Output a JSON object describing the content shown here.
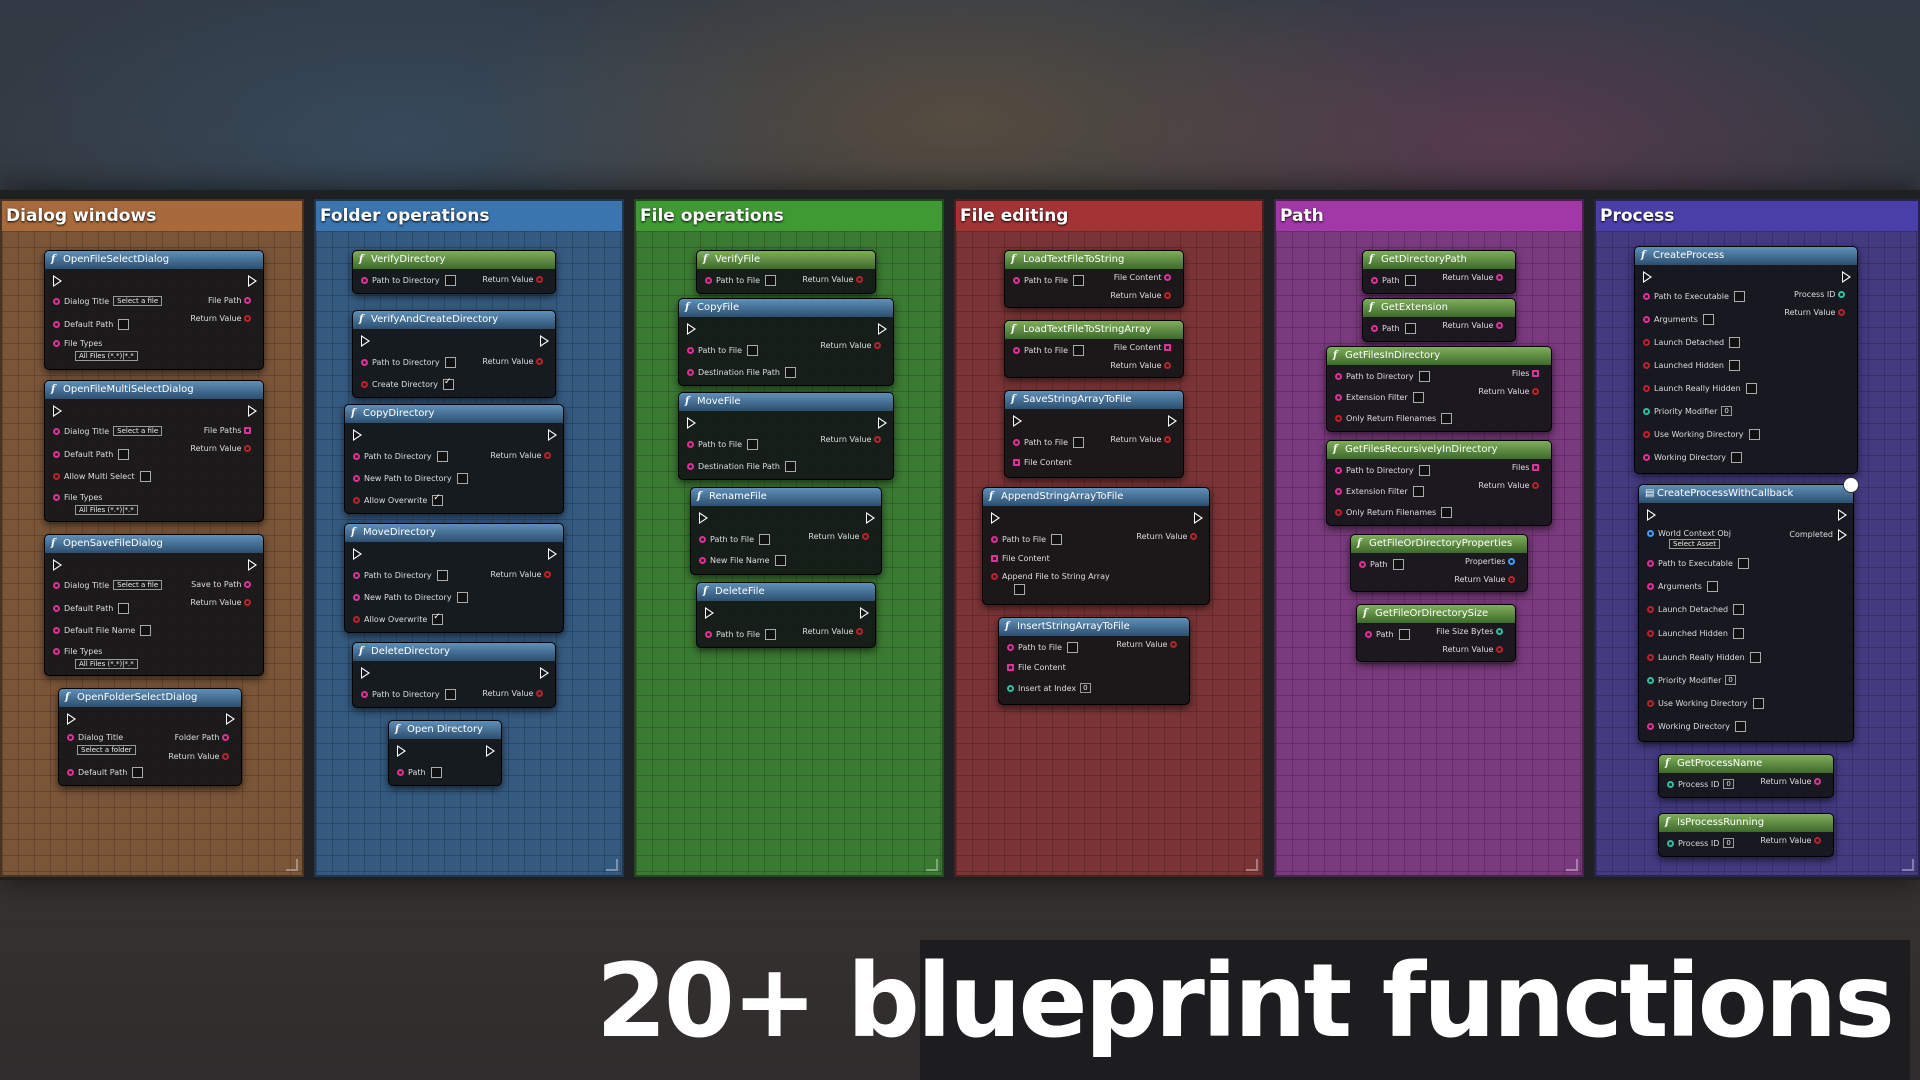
{
  "banner": "20+ blueprint functions",
  "columns": [
    {
      "title": "Dialog windows",
      "color": "#a86a3c"
    },
    {
      "title": "Folder operations",
      "color": "#3a75b0"
    },
    {
      "title": "File operations",
      "color": "#3f9a34"
    },
    {
      "title": "File editing",
      "color": "#a23436"
    },
    {
      "title": "Path",
      "color": "#a238a8"
    },
    {
      "title": "Process",
      "color": "#4a3ea8"
    }
  ],
  "nodes": {
    "openFileSelectDialog": {
      "title": "OpenFileSelectDialog",
      "dialog_title": "Dialog Title",
      "dialog_title_value": "Select a file",
      "default_path": "Default Path",
      "file_types": "File Types",
      "file_types_value": "All Files (*.*)|*.*",
      "out1": "File Path",
      "out2": "Return Value"
    },
    "openFileMultiSelectDialog": {
      "title": "OpenFileMultiSelectDialog",
      "dialog_title": "Dialog Title",
      "dialog_title_value": "Select a file",
      "default_path": "Default Path",
      "allow_multi": "Allow Multi Select",
      "file_types": "File Types",
      "file_types_value": "All Files (*.*)|*.*",
      "out1": "File Paths",
      "out2": "Return Value"
    },
    "openSaveFileDialog": {
      "title": "OpenSaveFileDialog",
      "dialog_title": "Dialog Title",
      "dialog_title_value": "Select a file",
      "default_path": "Default Path",
      "default_file_name": "Default File Name",
      "file_types": "File Types",
      "file_types_value": "All Files (*.*)|*.*",
      "out1": "Save to Path",
      "out2": "Return Value"
    },
    "openFolderSelectDialog": {
      "title": "OpenFolderSelectDialog",
      "dialog_title": "Dialog Title",
      "dialog_title_value": "Select a folder",
      "default_path": "Default Path",
      "out1": "Folder Path",
      "out2": "Return Value"
    },
    "verifyDirectory": {
      "title": "VerifyDirectory",
      "in1": "Path to Directory",
      "out1": "Return Value"
    },
    "verifyAndCreateDirectory": {
      "title": "VerifyAndCreateDirectory",
      "in1": "Path to Directory",
      "in2": "Create Directory",
      "out1": "Return Value"
    },
    "copyDirectory": {
      "title": "CopyDirectory",
      "in1": "Path to Directory",
      "in2": "New Path to Directory",
      "in3": "Allow Overwrite",
      "out1": "Return Value"
    },
    "moveDirectory": {
      "title": "MoveDirectory",
      "in1": "Path to Directory",
      "in2": "New Path to Directory",
      "in3": "Allow Overwrite",
      "out1": "Return Value"
    },
    "deleteDirectory": {
      "title": "DeleteDirectory",
      "in1": "Path to Directory",
      "out1": "Return Value"
    },
    "openDirectory": {
      "title": "Open Directory",
      "in1": "Path"
    },
    "verifyFile": {
      "title": "VerifyFile",
      "in1": "Path to File",
      "out1": "Return Value"
    },
    "copyFile": {
      "title": "CopyFile",
      "in1": "Path to File",
      "in2": "Destination File Path",
      "out1": "Return Value"
    },
    "moveFile": {
      "title": "MoveFile",
      "in1": "Path to File",
      "in2": "Destination File Path",
      "out1": "Return Value"
    },
    "renameFile": {
      "title": "RenameFile",
      "in1": "Path to File",
      "in2": "New File Name",
      "out1": "Return Value"
    },
    "deleteFile": {
      "title": "DeleteFile",
      "in1": "Path to File",
      "out1": "Return Value"
    },
    "loadTextFileToString": {
      "title": "LoadTextFileToString",
      "in1": "Path to File",
      "out1": "File Content",
      "out2": "Return Value"
    },
    "loadTextFileToStringArray": {
      "title": "LoadTextFileToStringArray",
      "in1": "Path to File",
      "out1": "File Content",
      "out2": "Return Value"
    },
    "saveStringArrayToFile": {
      "title": "SaveStringArrayToFile",
      "in1": "Path to File",
      "in2": "File Content",
      "out1": "Return Value"
    },
    "appendStringArrayToFile": {
      "title": "AppendStringArrayToFile",
      "in1": "Path to File",
      "in2": "File Content",
      "in3": "Append File to String Array",
      "out1": "Return Value"
    },
    "insertStringArrayToFile": {
      "title": "InsertStringArrayToFile",
      "in1": "Path to File",
      "in2": "File Content",
      "in3": "Insert at Index",
      "in3_value": "0",
      "out1": "Return Value"
    },
    "getDirectoryPath": {
      "title": "GetDirectoryPath",
      "in1": "Path",
      "out1": "Return Value"
    },
    "getExtension": {
      "title": "GetExtension",
      "in1": "Path",
      "out1": "Return Value"
    },
    "getFilesInDirectory": {
      "title": "GetFilesInDirectory",
      "in1": "Path to Directory",
      "in2": "Extension Filter",
      "in3": "Only Return Filenames",
      "out1": "Files",
      "out2": "Return Value"
    },
    "getFilesRecursivelyInDirectory": {
      "title": "GetFilesRecursivelyInDirectory",
      "in1": "Path to Directory",
      "in2": "Extension Filter",
      "in3": "Only Return Filenames",
      "out1": "Files",
      "out2": "Return Value"
    },
    "getFileOrDirectoryProperties": {
      "title": "GetFileOrDirectoryProperties",
      "in1": "Path",
      "out1": "Properties",
      "out2": "Return Value"
    },
    "getFileOrDirectorySize": {
      "title": "GetFileOrDirectorySize",
      "in1": "Path",
      "out1": "File Size Bytes",
      "out2": "Return Value"
    },
    "createProcess": {
      "title": "CreateProcess",
      "in1": "Path to Executable",
      "in2": "Arguments",
      "in3": "Launch Detached",
      "in4": "Launched Hidden",
      "in5": "Launch Really Hidden",
      "in6": "Priority Modifier",
      "in6_value": "0",
      "in7": "Use Working Directory",
      "in8": "Working Directory",
      "out1": "Process ID",
      "out2": "Return Value"
    },
    "createProcessWithCallback": {
      "title": "CreateProcessWithCallback",
      "in0": "World Context Obj",
      "in0_value": "Select Asset",
      "in1": "Path to Executable",
      "in2": "Arguments",
      "in3": "Launch Detached",
      "in4": "Launched Hidden",
      "in5": "Launch Really Hidden",
      "in6": "Priority Modifier",
      "in6_value": "0",
      "in7": "Use Working Directory",
      "in8": "Working Directory",
      "out1": "Completed"
    },
    "getProcessName": {
      "title": "GetProcessName",
      "in1": "Process ID",
      "in1_value": "0",
      "out1": "Return Value"
    },
    "isProcessRunning": {
      "title": "IsProcessRunning",
      "in1": "Process ID",
      "in1_value": "0",
      "out1": "Return Value"
    }
  }
}
